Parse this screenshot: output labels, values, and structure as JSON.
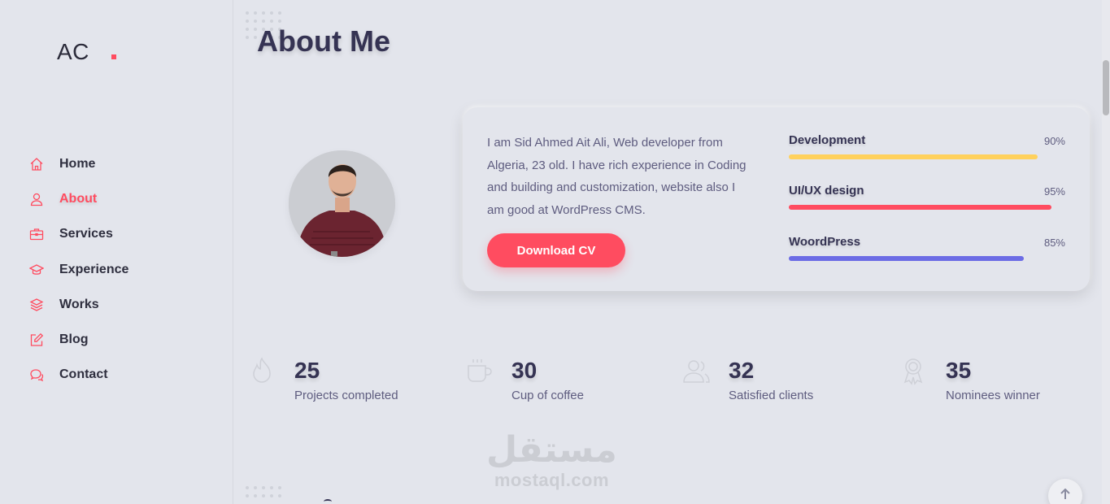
{
  "logo": {
    "text": "AC",
    "accent_color": "#ff4c60"
  },
  "nav": {
    "items": [
      {
        "label": "Home",
        "icon": "home-icon",
        "active": false
      },
      {
        "label": "About",
        "icon": "user-icon",
        "active": true
      },
      {
        "label": "Services",
        "icon": "briefcase-icon",
        "active": false
      },
      {
        "label": "Experience",
        "icon": "graduation-cap-icon",
        "active": false
      },
      {
        "label": "Works",
        "icon": "layers-icon",
        "active": false
      },
      {
        "label": "Blog",
        "icon": "edit-icon",
        "active": false
      },
      {
        "label": "Contact",
        "icon": "chat-bubbles-icon",
        "active": false
      }
    ]
  },
  "about": {
    "title": "About Me",
    "bio": "I am Sid Ahmed Ait Ali, Web developer from Algeria, 23 old. I have rich experience in Coding and building and customization, website also I am good at WordPress CMS.",
    "download_label": "Download CV",
    "skills": [
      {
        "name": "Development",
        "percent_label": "90%",
        "percent": 90,
        "color": "#ffd15c"
      },
      {
        "name": "UI/UX design",
        "percent_label": "95%",
        "percent": 95,
        "color": "#ff4c60"
      },
      {
        "name": "WoordPress",
        "percent_label": "85%",
        "percent": 85,
        "color": "#6c6ce5"
      }
    ]
  },
  "facts": [
    {
      "number": "25",
      "label": "Projects completed",
      "icon": "fire-icon"
    },
    {
      "number": "30",
      "label": "Cup of coffee",
      "icon": "coffee-cup-icon"
    },
    {
      "number": "32",
      "label": "Satisfied clients",
      "icon": "users-icon"
    },
    {
      "number": "35",
      "label": "Nominees winner",
      "icon": "award-icon"
    }
  ],
  "watermark": {
    "arabic": "مستقل",
    "latin": "mostaql.com"
  },
  "colors": {
    "background": "#e3e5ec",
    "accent": "#ff4c60",
    "text": "#353353"
  }
}
